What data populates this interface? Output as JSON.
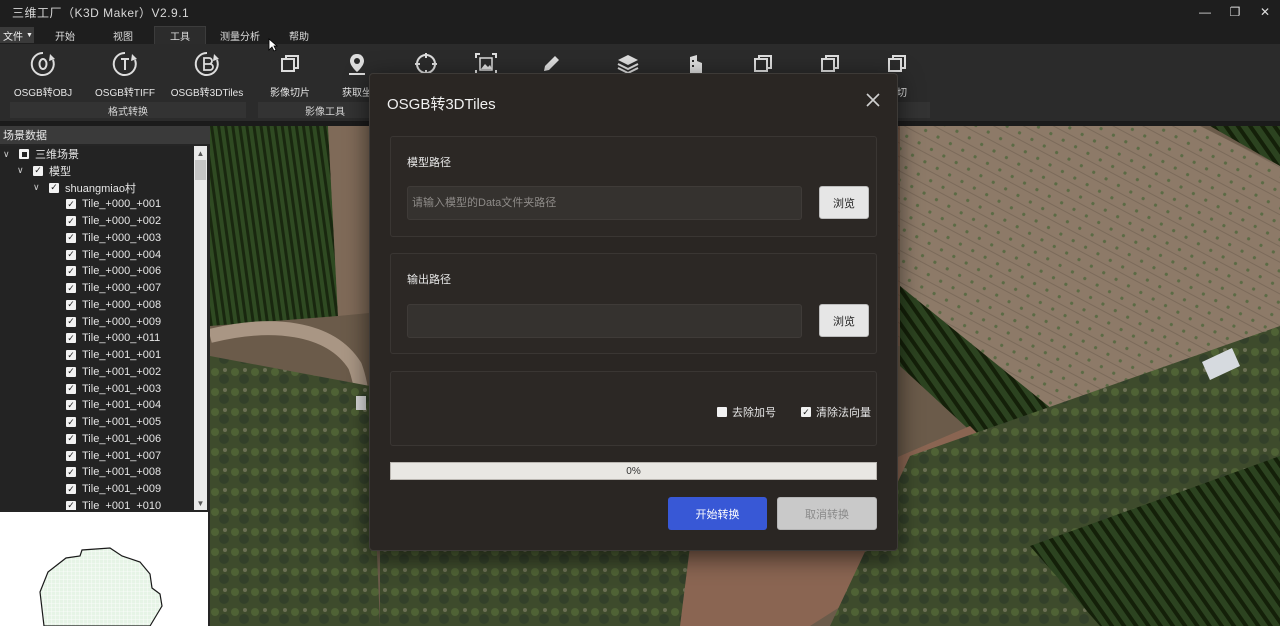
{
  "window": {
    "title": "三维工厂（K3D Maker）V2.9.1",
    "controls": [
      "—",
      "❐",
      "✕"
    ]
  },
  "menu": {
    "file": "文件",
    "tabs": [
      {
        "label": "开始",
        "active": false
      },
      {
        "label": "视图",
        "active": false
      },
      {
        "label": "工具",
        "active": true
      },
      {
        "label": "测量分析",
        "active": false
      },
      {
        "label": "帮助",
        "active": false
      }
    ]
  },
  "ribbon": {
    "buttons": [
      {
        "label": "OSGB转OBJ",
        "icon": "osgb-obj-icon"
      },
      {
        "label": "OSGB转TIFF",
        "icon": "osgb-tiff-icon"
      },
      {
        "label": "OSGB转3DTiles",
        "icon": "osgb-3dtiles-icon"
      },
      {
        "label": "影像切片",
        "icon": "image-tile-icon"
      },
      {
        "label": "获取坐",
        "icon": "location-pin-icon"
      },
      {
        "label": "",
        "icon": "target-icon"
      },
      {
        "label": "",
        "icon": "image-frame-icon"
      },
      {
        "label": "",
        "icon": "pencil-icon"
      },
      {
        "label": "",
        "icon": "layers-icon"
      },
      {
        "label": "",
        "icon": "buildings-icon"
      },
      {
        "label": "",
        "icon": "copy-icon"
      },
      {
        "label": "",
        "icon": "copy-icon"
      },
      {
        "label": "裁切",
        "icon": "copy-icon"
      }
    ],
    "groups": [
      "格式转换",
      "影像工具"
    ]
  },
  "left_panel": {
    "title": "场景数据",
    "tree": [
      {
        "label": "三维场景",
        "check": "partial",
        "level": 0
      },
      {
        "label": "模型",
        "check": "checked",
        "level": 1
      },
      {
        "label": "shuangmiao村",
        "check": "checked",
        "level": 2
      },
      {
        "label": "Tile_+000_+001",
        "check": "checked",
        "level": 3
      },
      {
        "label": "Tile_+000_+002",
        "check": "checked",
        "level": 3
      },
      {
        "label": "Tile_+000_+003",
        "check": "checked",
        "level": 3
      },
      {
        "label": "Tile_+000_+004",
        "check": "checked",
        "level": 3
      },
      {
        "label": "Tile_+000_+006",
        "check": "checked",
        "level": 3
      },
      {
        "label": "Tile_+000_+007",
        "check": "checked",
        "level": 3
      },
      {
        "label": "Tile_+000_+008",
        "check": "checked",
        "level": 3
      },
      {
        "label": "Tile_+000_+009",
        "check": "checked",
        "level": 3
      },
      {
        "label": "Tile_+000_+011",
        "check": "checked",
        "level": 3
      },
      {
        "label": "Tile_+001_+001",
        "check": "checked",
        "level": 3
      },
      {
        "label": "Tile_+001_+002",
        "check": "checked",
        "level": 3
      },
      {
        "label": "Tile_+001_+003",
        "check": "checked",
        "level": 3
      },
      {
        "label": "Tile_+001_+004",
        "check": "checked",
        "level": 3
      },
      {
        "label": "Tile_+001_+005",
        "check": "checked",
        "level": 3
      },
      {
        "label": "Tile_+001_+006",
        "check": "checked",
        "level": 3
      },
      {
        "label": "Tile_+001_+007",
        "check": "checked",
        "level": 3
      },
      {
        "label": "Tile_+001_+008",
        "check": "checked",
        "level": 3
      },
      {
        "label": "Tile_+001_+009",
        "check": "checked",
        "level": 3
      },
      {
        "label": "Tile_+001_+010",
        "check": "checked",
        "level": 3
      }
    ]
  },
  "dialog": {
    "title": "OSGB转3DTiles",
    "model_path": {
      "label": "模型路径",
      "value": "",
      "placeholder": "请输入模型的Data文件夹路径",
      "browse": "浏览"
    },
    "output_path": {
      "label": "输出路径",
      "value": "",
      "placeholder": "",
      "browse": "浏览"
    },
    "options": [
      {
        "label": "去除加号",
        "checked": false
      },
      {
        "label": "清除法向量",
        "checked": true
      }
    ],
    "progress": {
      "value": 0,
      "text": "0%"
    },
    "start": "开始转换",
    "cancel": "取消转换"
  },
  "colors": {
    "accent": "#3858d6",
    "dialog_bg": "#2a2623",
    "ribbon_bg": "#2b2b2b"
  }
}
